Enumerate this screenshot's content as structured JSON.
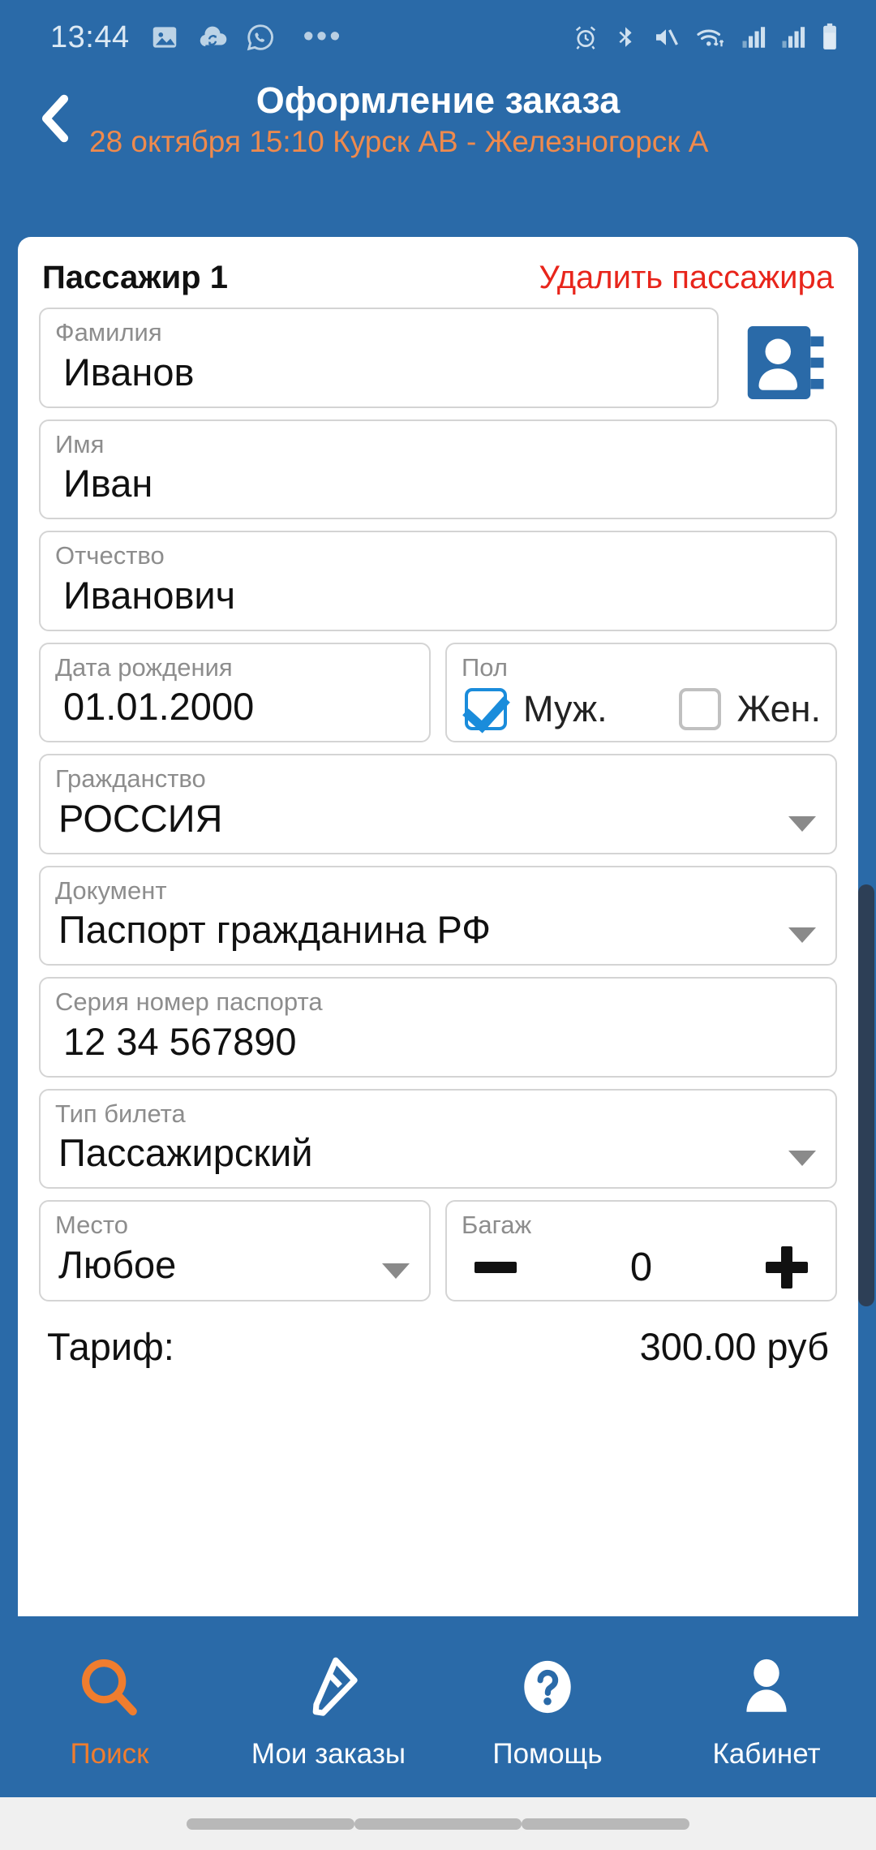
{
  "status_bar": {
    "time": "13:44",
    "left_icons": [
      "gallery-icon",
      "cloud-sync-icon",
      "whatsapp-icon",
      "overflow-dots-icon"
    ],
    "right_icons": [
      "alarm-icon",
      "bluetooth-icon",
      "mute-icon",
      "wifi-icon",
      "signal-icon",
      "signal-icon-2",
      "battery-icon"
    ]
  },
  "header": {
    "back_icon": "chevron-left-icon",
    "title": "Оформление заказа",
    "subtitle": "28 октября 15:10 Курск АВ - Железногорск А"
  },
  "passenger_card": {
    "title": "Пассажир 1",
    "delete_label": "Удалить пассажира",
    "contact_icon": "address-book-icon",
    "fields": {
      "surname": {
        "label": "Фамилия",
        "value": "Иванов"
      },
      "firstname": {
        "label": "Имя",
        "value": "Иван"
      },
      "patronymic": {
        "label": "Отчество",
        "value": "Иванович"
      },
      "birthdate": {
        "label": "Дата рождения",
        "value": "01.01.2000"
      },
      "gender": {
        "label": "Пол",
        "male_label": "Муж.",
        "female_label": "Жен.",
        "male_checked": true,
        "female_checked": false
      },
      "citizenship": {
        "label": "Гражданство",
        "value": "РОССИЯ"
      },
      "document": {
        "label": "Документ",
        "value": "Паспорт гражданина РФ"
      },
      "passport_number": {
        "label": "Серия номер паспорта",
        "value": "12 34 567890"
      },
      "ticket_type": {
        "label": "Тип билета",
        "value": "Пассажирский"
      },
      "seat": {
        "label": "Место",
        "value": "Любое"
      },
      "baggage": {
        "label": "Багаж",
        "value": "0",
        "minus_label": "−",
        "plus_label": "+"
      }
    },
    "tariff": {
      "label": "Тариф:",
      "value": "300.00 руб"
    }
  },
  "bottom_nav": {
    "items": [
      {
        "label": "Поиск",
        "icon": "search-icon",
        "active": true
      },
      {
        "label": "Мои заказы",
        "icon": "ticket-icon",
        "active": false
      },
      {
        "label": "Помощь",
        "icon": "question-circle-icon",
        "active": false
      },
      {
        "label": "Кабинет",
        "icon": "person-icon",
        "active": false
      }
    ]
  },
  "colors": {
    "brand_blue": "#2a6aa8",
    "accent_orange": "#f07d2e",
    "danger_red": "#e8251b",
    "checkbox_blue": "#1a8cdb"
  }
}
